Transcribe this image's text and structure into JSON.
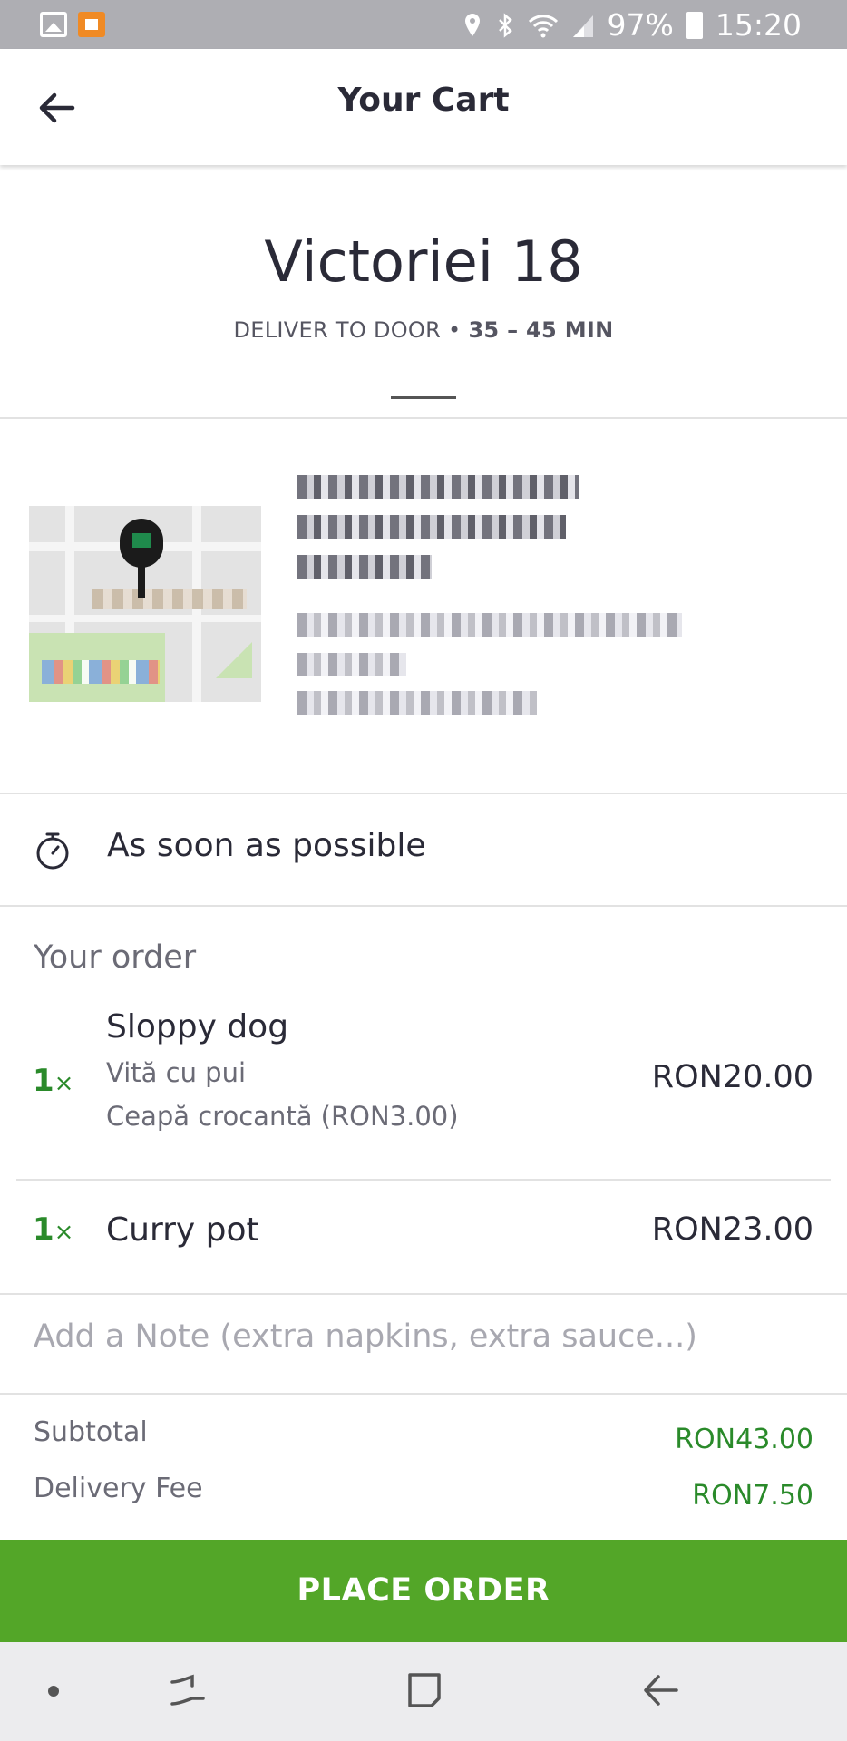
{
  "status_bar": {
    "battery": "97%",
    "time": "15:20"
  },
  "app_bar": {
    "title": "Your Cart"
  },
  "restaurant": {
    "name": "Victoriei 18",
    "delivery_mode": "DELIVER TO DOOR",
    "separator": "•",
    "eta": "35 – 45 MIN"
  },
  "schedule": {
    "label": "As soon as possible"
  },
  "order": {
    "heading": "Your order",
    "items": [
      {
        "qty": "1",
        "qty_mark": "×",
        "name": "Sloppy dog",
        "options": [
          "Vită cu pui",
          "Ceapă crocantă (RON3.00)"
        ],
        "price": "RON20.00"
      },
      {
        "qty": "1",
        "qty_mark": "×",
        "name": "Curry pot",
        "options": [],
        "price": "RON23.00"
      }
    ]
  },
  "note": {
    "placeholder": "Add a Note (extra napkins, extra sauce...)",
    "value": ""
  },
  "totals": {
    "subtotal_label": "Subtotal",
    "subtotal_value": "RON43.00",
    "delivery_label": "Delivery Fee",
    "delivery_value": "RON7.50"
  },
  "cta": {
    "label": "PLACE ORDER"
  },
  "colors": {
    "accent_green": "#53a628",
    "price_green": "#2a8a2a",
    "text_dark": "#2a2a37"
  }
}
